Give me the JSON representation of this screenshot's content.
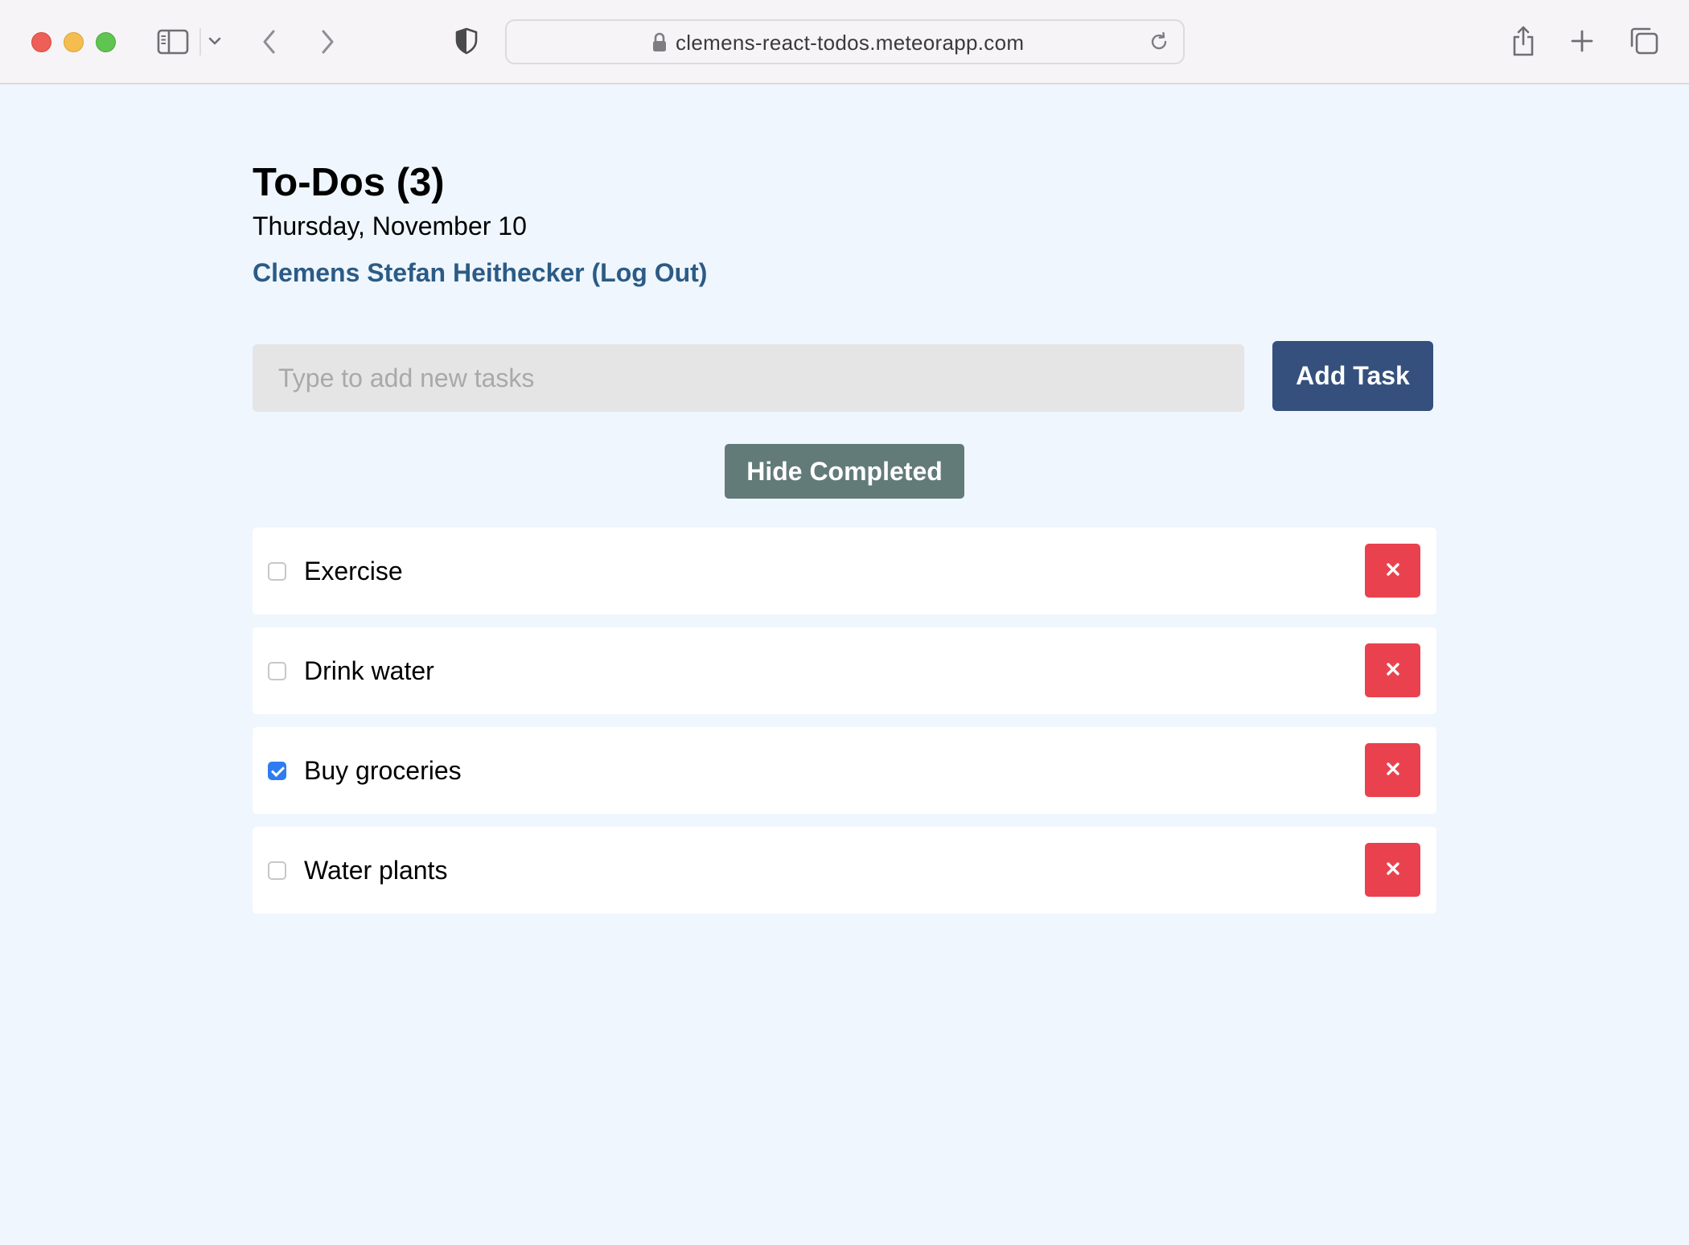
{
  "browser": {
    "url": "clemens-react-todos.meteorapp.com",
    "icons": {
      "sidebar": "sidebar-icon",
      "sidebar_menu": "chevron-down-icon",
      "back": "chevron-left-icon",
      "forward": "chevron-right-icon",
      "privacy": "shield-icon",
      "lock": "lock-icon",
      "reload": "reload-icon",
      "share": "share-icon",
      "new_tab": "plus-icon",
      "tab_overview": "tabs-icon"
    },
    "traffic_colors": {
      "close": "#ed5f57",
      "minimize": "#f5bd4f",
      "maximize": "#60c452"
    }
  },
  "app": {
    "title": "To-Dos (3)",
    "date": "Thursday, November 10",
    "user_link": "Clemens Stefan Heithecker (Log Out)",
    "new_task": {
      "placeholder": "Type to add new tasks",
      "value": ""
    },
    "add_button": "Add Task",
    "hide_completed_button": "Hide Completed",
    "tasks": [
      {
        "text": "Exercise",
        "checked": false
      },
      {
        "text": "Drink water",
        "checked": false
      },
      {
        "text": "Buy groceries",
        "checked": true
      },
      {
        "text": "Water plants",
        "checked": false
      }
    ],
    "delete_icon": "close-icon"
  },
  "colors": {
    "page_background": "#eff6fd",
    "add_button": "#35507d",
    "hide_button": "#637b78",
    "delete_button": "#e9424e",
    "link": "#2b5b86",
    "checkbox_checked": "#2f7cf2"
  }
}
